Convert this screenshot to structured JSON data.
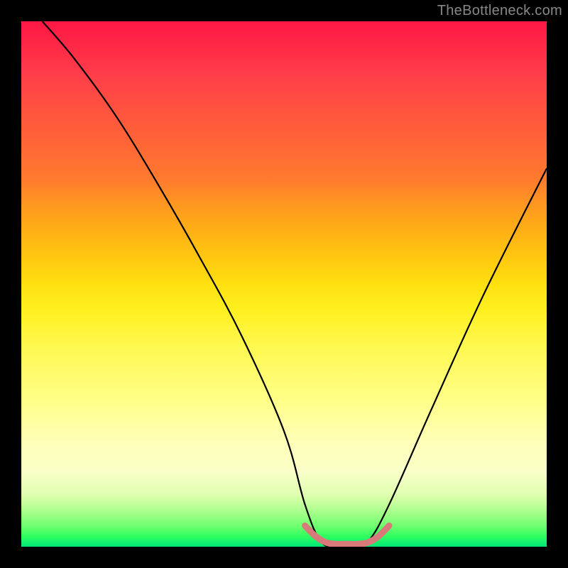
{
  "watermark": "TheBottleneck.com",
  "chart_data": {
    "type": "line",
    "title": "",
    "xlabel": "",
    "ylabel": "",
    "xlim": [
      0,
      100
    ],
    "ylim": [
      0,
      100
    ],
    "background_gradient": {
      "direction": "vertical",
      "stops": [
        {
          "pos": 0,
          "color": "#ff1744",
          "meaning": "high-bottleneck"
        },
        {
          "pos": 50,
          "color": "#ffe010",
          "meaning": "mid"
        },
        {
          "pos": 100,
          "color": "#00e676",
          "meaning": "optimal"
        }
      ]
    },
    "series": [
      {
        "name": "bottleneck-curve",
        "color": "#000000",
        "x": [
          4,
          10,
          18,
          26,
          34,
          42,
          50,
          54,
          57,
          60,
          63,
          66,
          70,
          78,
          88,
          100
        ],
        "values": [
          100,
          93,
          82,
          69,
          55,
          40,
          22,
          8,
          1,
          0,
          0,
          1,
          8,
          26,
          48,
          72
        ]
      },
      {
        "name": "optimal-band-marker",
        "color": "#d97a7a",
        "x": [
          54,
          56,
          58,
          60,
          62,
          64,
          66,
          68,
          70
        ],
        "values": [
          4,
          2,
          0.8,
          0.5,
          0.5,
          0.5,
          0.8,
          2,
          4
        ]
      }
    ],
    "annotations": []
  }
}
